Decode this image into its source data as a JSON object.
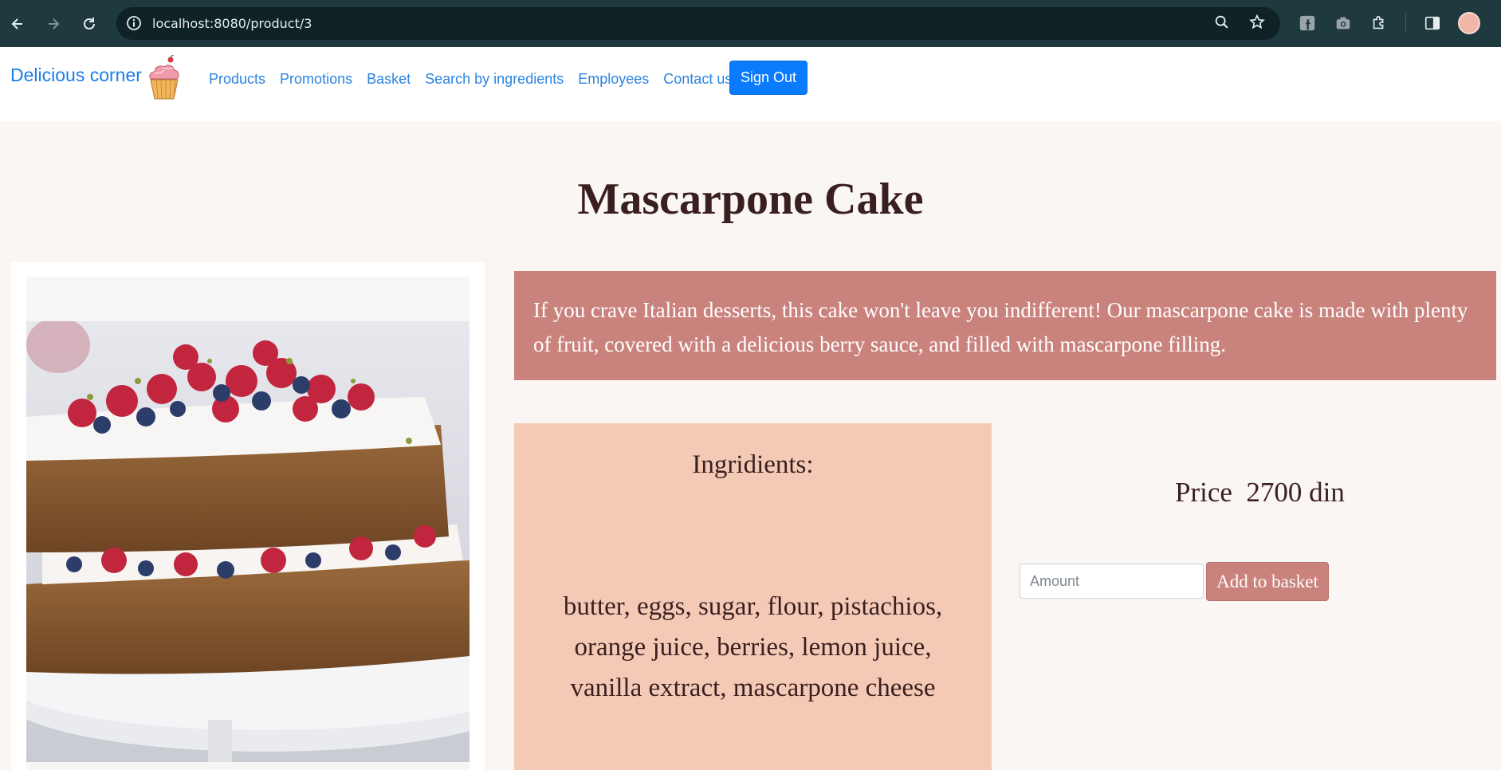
{
  "browser": {
    "url": "localhost:8080/product/3",
    "icons": [
      "back-icon",
      "forward-icon",
      "reload-icon",
      "site-info-icon",
      "zoom-icon",
      "bookmark-star-icon",
      "facebook-extension-icon",
      "camera-extension-icon",
      "extensions-puzzle-icon",
      "side-panel-icon",
      "profile-avatar"
    ]
  },
  "navbar": {
    "brand": "Delicious corner",
    "links": [
      "Products",
      "Promotions",
      "Basket",
      "Search by ingredients",
      "Employees",
      "Contact us"
    ],
    "signout": "Sign Out"
  },
  "product": {
    "title": "Mascarpone Cake",
    "description": "If you crave Italian desserts, this cake won't leave you indifferent! Our mascarpone cake is made with plenty of fruit, covered with a delicious berry sauce, and filled with mascarpone filling.",
    "ingredients_title": "Ingridients:",
    "ingredients": "butter, eggs, sugar, flour, pistachios, orange juice, berries, lemon juice, vanilla extract, mascarpone cheese",
    "price_label": "Price",
    "price_value": "2700 din",
    "amount_placeholder": "Amount",
    "add_button": "Add to basket"
  },
  "colors": {
    "accent": "#ca827c",
    "ingredients_bg": "#f4cab6",
    "link": "#2c84e0",
    "signout": "#0a7bfc"
  }
}
